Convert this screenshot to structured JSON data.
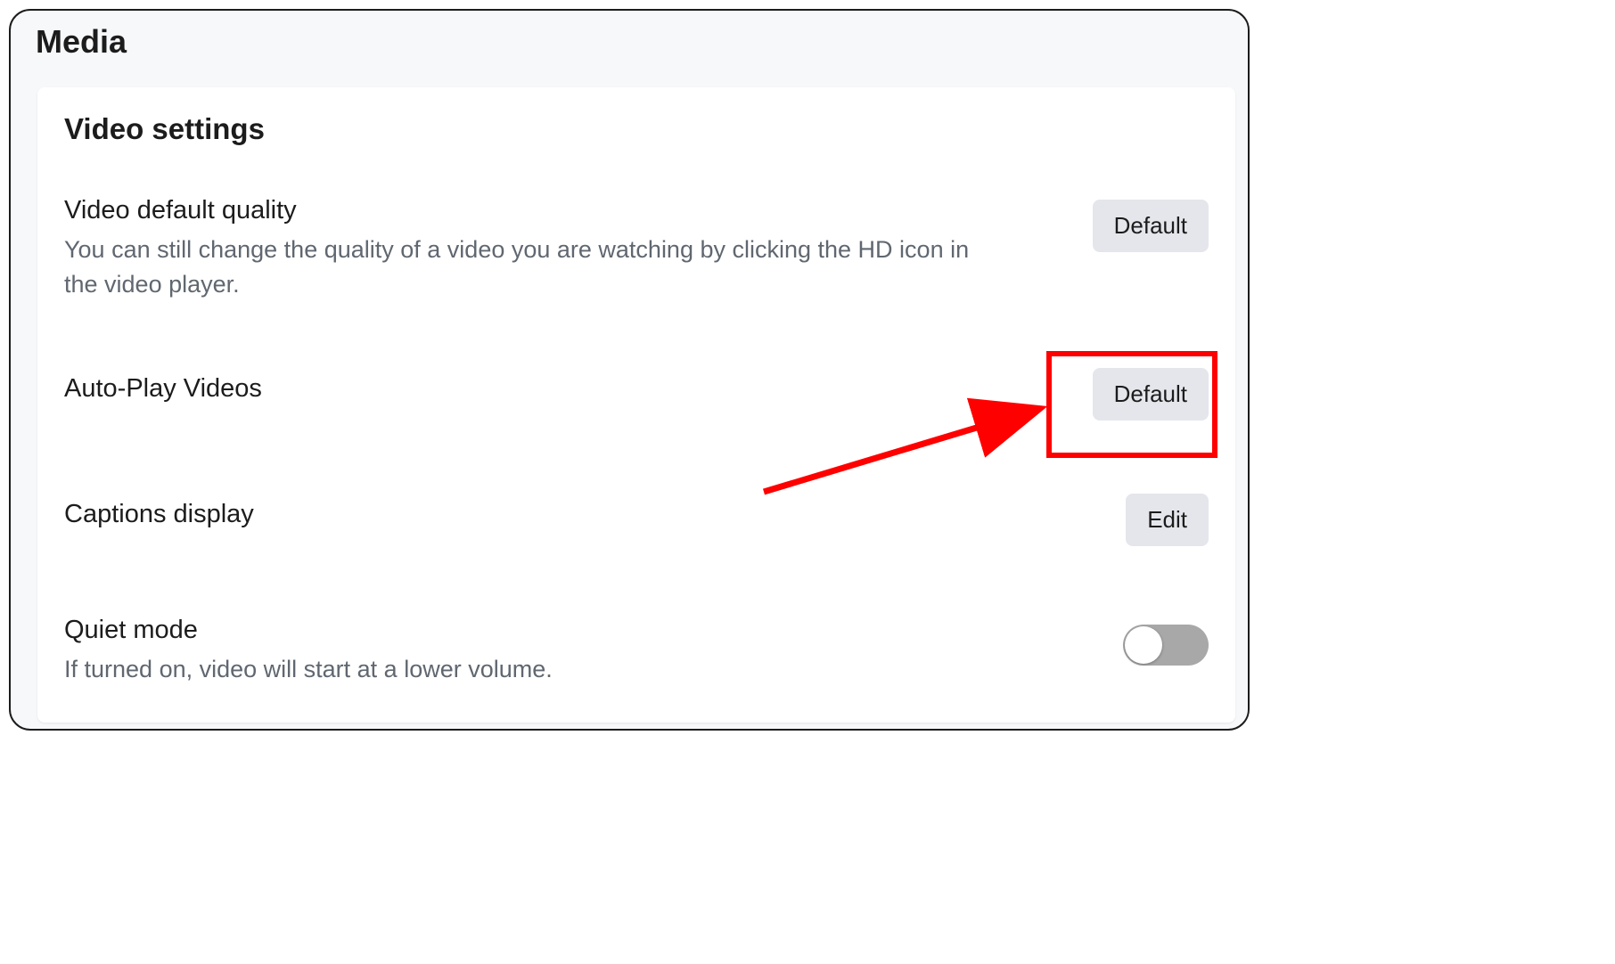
{
  "page": {
    "title": "Media"
  },
  "card": {
    "title": "Video settings"
  },
  "settings": {
    "videoQuality": {
      "label": "Video default quality",
      "description": "You can still change the quality of a video you are watching by clicking the HD icon in the video player.",
      "button": "Default"
    },
    "autoPlay": {
      "label": "Auto-Play Videos",
      "button": "Default"
    },
    "captions": {
      "label": "Captions display",
      "button": "Edit"
    },
    "quietMode": {
      "label": "Quiet mode",
      "description": "If turned on, video will start at a lower volume.",
      "enabled": false
    }
  }
}
